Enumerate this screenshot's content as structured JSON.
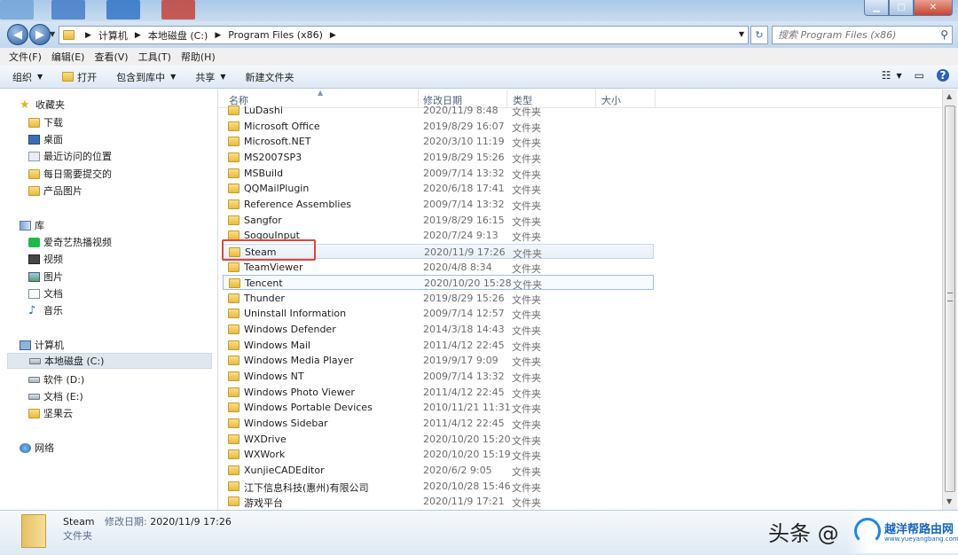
{
  "window": {
    "buttons": {
      "minimize": "▁",
      "maximize": "□",
      "close": "✕"
    }
  },
  "address": {
    "back": "◀",
    "forward": "▶",
    "crumbs": [
      "计算机",
      "本地磁盘 (C:)",
      "Program Files (x86)"
    ],
    "dropdown": "▼",
    "refresh": "↻"
  },
  "search": {
    "placeholder": "搜索 Program Files (x86)",
    "icon": "search-icon"
  },
  "menu": [
    "文件(F)",
    "编辑(E)",
    "查看(V)",
    "工具(T)",
    "帮助(H)"
  ],
  "toolbar": {
    "organize": "组织",
    "open": "打开",
    "include": "包含到库中",
    "share": "共享",
    "new_folder": "新建文件夹",
    "view_icon": "☷",
    "preview_icon": "▭",
    "help": "?"
  },
  "sidebar": {
    "favorites_title": "收藏夹",
    "favorites": [
      "下载",
      "桌面",
      "最近访问的位置",
      "每日需要提交的",
      "产品图片"
    ],
    "libraries_title": "库",
    "libraries": [
      "爱奇艺热播视频",
      "视频",
      "图片",
      "文档",
      "音乐"
    ],
    "computer_title": "计算机",
    "drives": [
      "本地磁盘 (C:)",
      "软件 (D:)",
      "文档 (E:)",
      "坚果云"
    ],
    "network_title": "网络"
  },
  "columns": {
    "name": "名称",
    "date": "修改日期",
    "type": "类型",
    "size": "大小"
  },
  "files": [
    {
      "name": "LuDashi",
      "date": "2020/11/9 8:48",
      "type": "文件夹"
    },
    {
      "name": "Microsoft Office",
      "date": "2019/8/29 16:07",
      "type": "文件夹"
    },
    {
      "name": "Microsoft.NET",
      "date": "2020/3/10 11:19",
      "type": "文件夹"
    },
    {
      "name": "MS2007SP3",
      "date": "2019/8/29 15:26",
      "type": "文件夹"
    },
    {
      "name": "MSBuild",
      "date": "2009/7/14 13:32",
      "type": "文件夹"
    },
    {
      "name": "QQMailPlugin",
      "date": "2020/6/18 17:41",
      "type": "文件夹"
    },
    {
      "name": "Reference Assemblies",
      "date": "2009/7/14 13:32",
      "type": "文件夹"
    },
    {
      "name": "Sangfor",
      "date": "2019/8/29 16:15",
      "type": "文件夹"
    },
    {
      "name": "SogouInput",
      "date": "2020/7/24 9:13",
      "type": "文件夹"
    },
    {
      "name": "Steam",
      "date": "2020/11/9 17:26",
      "type": "文件夹"
    },
    {
      "name": "TeamViewer",
      "date": "2020/4/8 8:34",
      "type": "文件夹"
    },
    {
      "name": "Tencent",
      "date": "2020/10/20 15:28",
      "type": "文件夹"
    },
    {
      "name": "Thunder",
      "date": "2019/8/29 15:26",
      "type": "文件夹"
    },
    {
      "name": "Uninstall Information",
      "date": "2009/7/14 12:57",
      "type": "文件夹"
    },
    {
      "name": "Windows Defender",
      "date": "2014/3/18 14:43",
      "type": "文件夹"
    },
    {
      "name": "Windows Mail",
      "date": "2011/4/12 22:45",
      "type": "文件夹"
    },
    {
      "name": "Windows Media Player",
      "date": "2019/9/17 9:09",
      "type": "文件夹"
    },
    {
      "name": "Windows NT",
      "date": "2009/7/14 13:32",
      "type": "文件夹"
    },
    {
      "name": "Windows Photo Viewer",
      "date": "2011/4/12 22:45",
      "type": "文件夹"
    },
    {
      "name": "Windows Portable Devices",
      "date": "2010/11/21 11:31",
      "type": "文件夹"
    },
    {
      "name": "Windows Sidebar",
      "date": "2011/4/12 22:45",
      "type": "文件夹"
    },
    {
      "name": "WXDrive",
      "date": "2020/10/20 15:20",
      "type": "文件夹"
    },
    {
      "name": "WXWork",
      "date": "2020/10/20 15:19",
      "type": "文件夹"
    },
    {
      "name": "XunjieCADEditor",
      "date": "2020/6/2 9:05",
      "type": "文件夹"
    },
    {
      "name": "江下信息科技(惠州)有限公司",
      "date": "2020/10/28 15:46",
      "type": "文件夹"
    },
    {
      "name": "游戏平台",
      "date": "2020/11/9 17:21",
      "type": "文件夹"
    }
  ],
  "details": {
    "name": "Steam",
    "date_label": "修改日期:",
    "date": "2020/11/9 17:26",
    "type": "文件夹"
  },
  "watermark": {
    "text": "头条 @",
    "brand": "越洋帮路由网",
    "url": "www.yueyangbang.com"
  },
  "colors": {
    "highlight_box": "#e0453a",
    "accent": "#2a63b3"
  }
}
